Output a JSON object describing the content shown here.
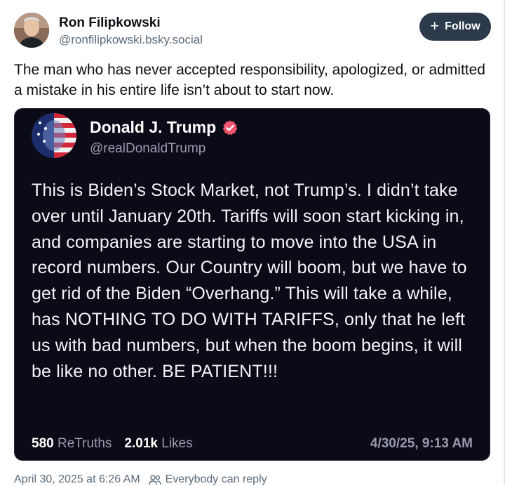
{
  "author": {
    "name": "Ron Filipkowski",
    "handle": "@ronfilipkowski.bsky.social",
    "avatar_icon": "profile-photo"
  },
  "follow_button": {
    "label": "Follow",
    "icon": "plus-icon"
  },
  "post": {
    "text": "The man who has never accepted responsibility, apologized, or admitted a mistake in his entire life isn’t about to start now."
  },
  "embedded_post": {
    "name": "Donald J. Trump",
    "handle": "@realDonaldTrump",
    "verified_color": "#f0546e",
    "body": "This is Biden’s Stock Market, not Trump’s. I didn’t take over until January 20th. Tariffs will soon start kicking in, and companies are starting to move into the USA in record numbers. Our Country will boom, but we have to get rid of the Biden “Overhang.” This will take a while, has NOTHING TO DO WITH TARIFFS, only that he left us with bad numbers, but when the boom begins, it will be like no other. BE PATIENT!!!",
    "retruths_count": "580",
    "retruths_label": "ReTruths",
    "likes_count": "2.01k",
    "likes_label": "Likes",
    "date": "4/30/25, 9:13 AM",
    "background": "#0b0a17"
  },
  "footer": {
    "timestamp": "April 30, 2025 at 6:26 AM",
    "reply_setting": "Everybody can reply"
  },
  "colors": {
    "button_bg": "#2c3a4b",
    "muted_text": "#5a6b7a"
  }
}
